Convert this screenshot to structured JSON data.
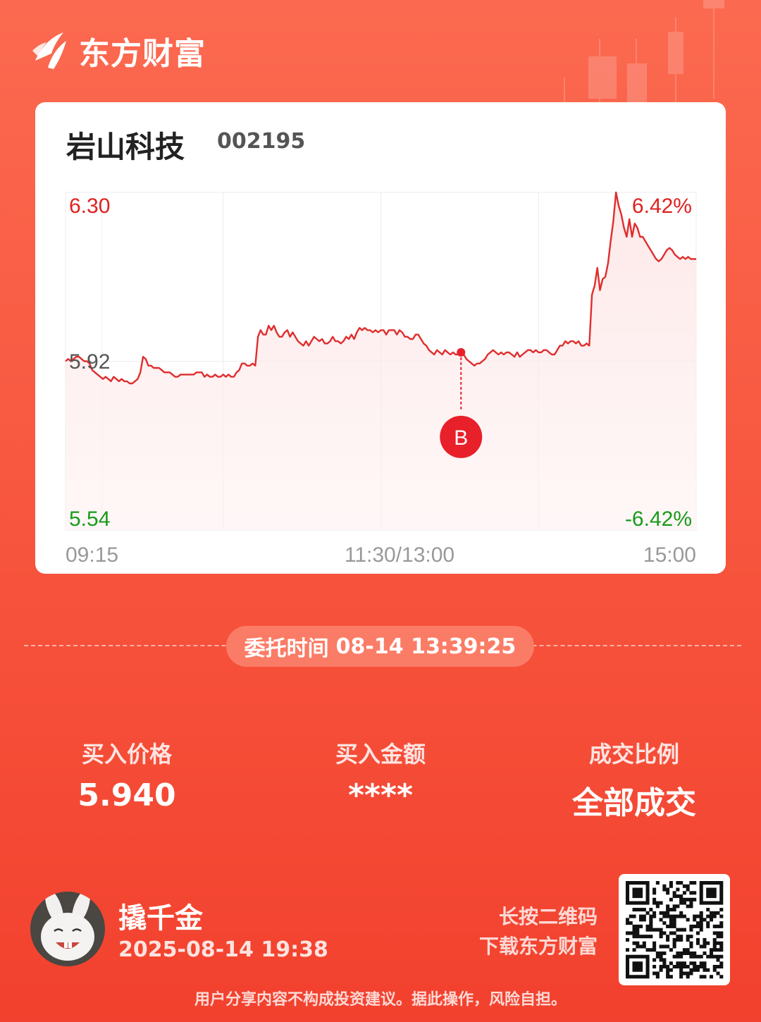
{
  "brand": {
    "name": "东方财富"
  },
  "stock": {
    "name": "岩山科技",
    "code": "002195"
  },
  "chart_data": {
    "type": "line",
    "y_range": [
      5.54,
      6.3
    ],
    "prev_close": 5.92,
    "y_labels": {
      "high": "6.30",
      "mid": "5.92",
      "low": "5.54"
    },
    "pct_labels": {
      "high": "6.42%",
      "low": "-6.42%"
    },
    "x_ticks": [
      "09:15",
      "11:30/13:00",
      "15:00"
    ],
    "marker": {
      "label": "B",
      "price": 5.94,
      "index": 148
    },
    "series": [
      {
        "values": [
          5.92,
          5.925,
          5.92,
          5.925,
          5.93,
          5.93,
          5.925,
          5.92,
          5.92,
          5.915,
          5.9,
          5.895,
          5.89,
          5.885,
          5.88,
          5.885,
          5.88,
          5.875,
          5.885,
          5.88,
          5.875,
          5.88,
          5.875,
          5.875,
          5.87,
          5.87,
          5.875,
          5.88,
          5.895,
          5.93,
          5.925,
          5.91,
          5.91,
          5.905,
          5.905,
          5.905,
          5.9,
          5.895,
          5.895,
          5.895,
          5.89,
          5.885,
          5.885,
          5.89,
          5.89,
          5.89,
          5.89,
          5.89,
          5.89,
          5.895,
          5.895,
          5.895,
          5.885,
          5.89,
          5.885,
          5.885,
          5.89,
          5.885,
          5.885,
          5.89,
          5.885,
          5.89,
          5.885,
          5.885,
          5.895,
          5.9,
          5.915,
          5.915,
          5.91,
          5.91,
          5.915,
          5.91,
          5.975,
          5.99,
          5.98,
          5.98,
          6.0,
          5.99,
          6.0,
          5.985,
          5.975,
          5.975,
          5.985,
          5.99,
          5.975,
          5.985,
          5.975,
          5.965,
          5.96,
          5.955,
          5.965,
          5.955,
          5.965,
          5.975,
          5.97,
          5.965,
          5.97,
          5.96,
          5.96,
          5.965,
          5.975,
          5.965,
          5.965,
          5.96,
          5.965,
          5.975,
          5.97,
          5.98,
          5.97,
          5.985,
          5.995,
          5.99,
          5.995,
          5.99,
          5.99,
          5.985,
          5.99,
          5.985,
          5.99,
          5.99,
          5.98,
          5.99,
          5.99,
          5.99,
          5.98,
          5.99,
          5.985,
          5.975,
          5.975,
          5.97,
          5.97,
          5.98,
          5.98,
          5.97,
          5.96,
          5.955,
          5.945,
          5.94,
          5.935,
          5.945,
          5.94,
          5.935,
          5.945,
          5.94,
          5.935,
          5.94,
          5.935,
          5.935,
          5.945,
          5.935,
          5.925,
          5.92,
          5.915,
          5.91,
          5.915,
          5.915,
          5.92,
          5.925,
          5.935,
          5.94,
          5.945,
          5.94,
          5.935,
          5.94,
          5.935,
          5.94,
          5.94,
          5.935,
          5.93,
          5.94,
          5.93,
          5.935,
          5.94,
          5.945,
          5.945,
          5.94,
          5.945,
          5.94,
          5.94,
          5.945,
          5.945,
          5.94,
          5.935,
          5.935,
          5.945,
          5.955,
          5.955,
          5.965,
          5.96,
          5.965,
          5.965,
          5.96,
          5.965,
          5.955,
          5.955,
          5.96,
          5.955,
          6.07,
          6.09,
          6.13,
          6.08,
          6.105,
          6.11,
          6.14,
          6.19,
          6.235,
          6.3,
          6.27,
          6.25,
          6.22,
          6.2,
          6.24,
          6.2,
          6.23,
          6.22,
          6.2,
          6.2,
          6.19,
          6.18,
          6.17,
          6.16,
          6.15,
          6.145,
          6.15,
          6.16,
          6.17,
          6.175,
          6.17,
          6.16,
          6.155,
          6.15,
          6.155,
          6.15,
          6.155,
          6.15,
          6.15,
          6.15
        ]
      }
    ]
  },
  "order": {
    "label": "委托时间",
    "time": "08-14 13:39:25"
  },
  "metrics": [
    {
      "label": "买入价格",
      "value": "5.940"
    },
    {
      "label": "买入金额",
      "value": "****"
    },
    {
      "label": "成交比例",
      "value": "全部成交"
    }
  ],
  "user": {
    "name": "撬千金",
    "time": "2025-08-14 19:38"
  },
  "qr_hint": {
    "line1": "长按二维码",
    "line2": "下载东方财富"
  },
  "disclaimer": "用户分享内容不构成投资建议。据此操作，风险自担。",
  "colors": {
    "up": "#e02020",
    "down": "#1a9a1a",
    "line": "#e02d2d",
    "marker": "#e8202a"
  }
}
